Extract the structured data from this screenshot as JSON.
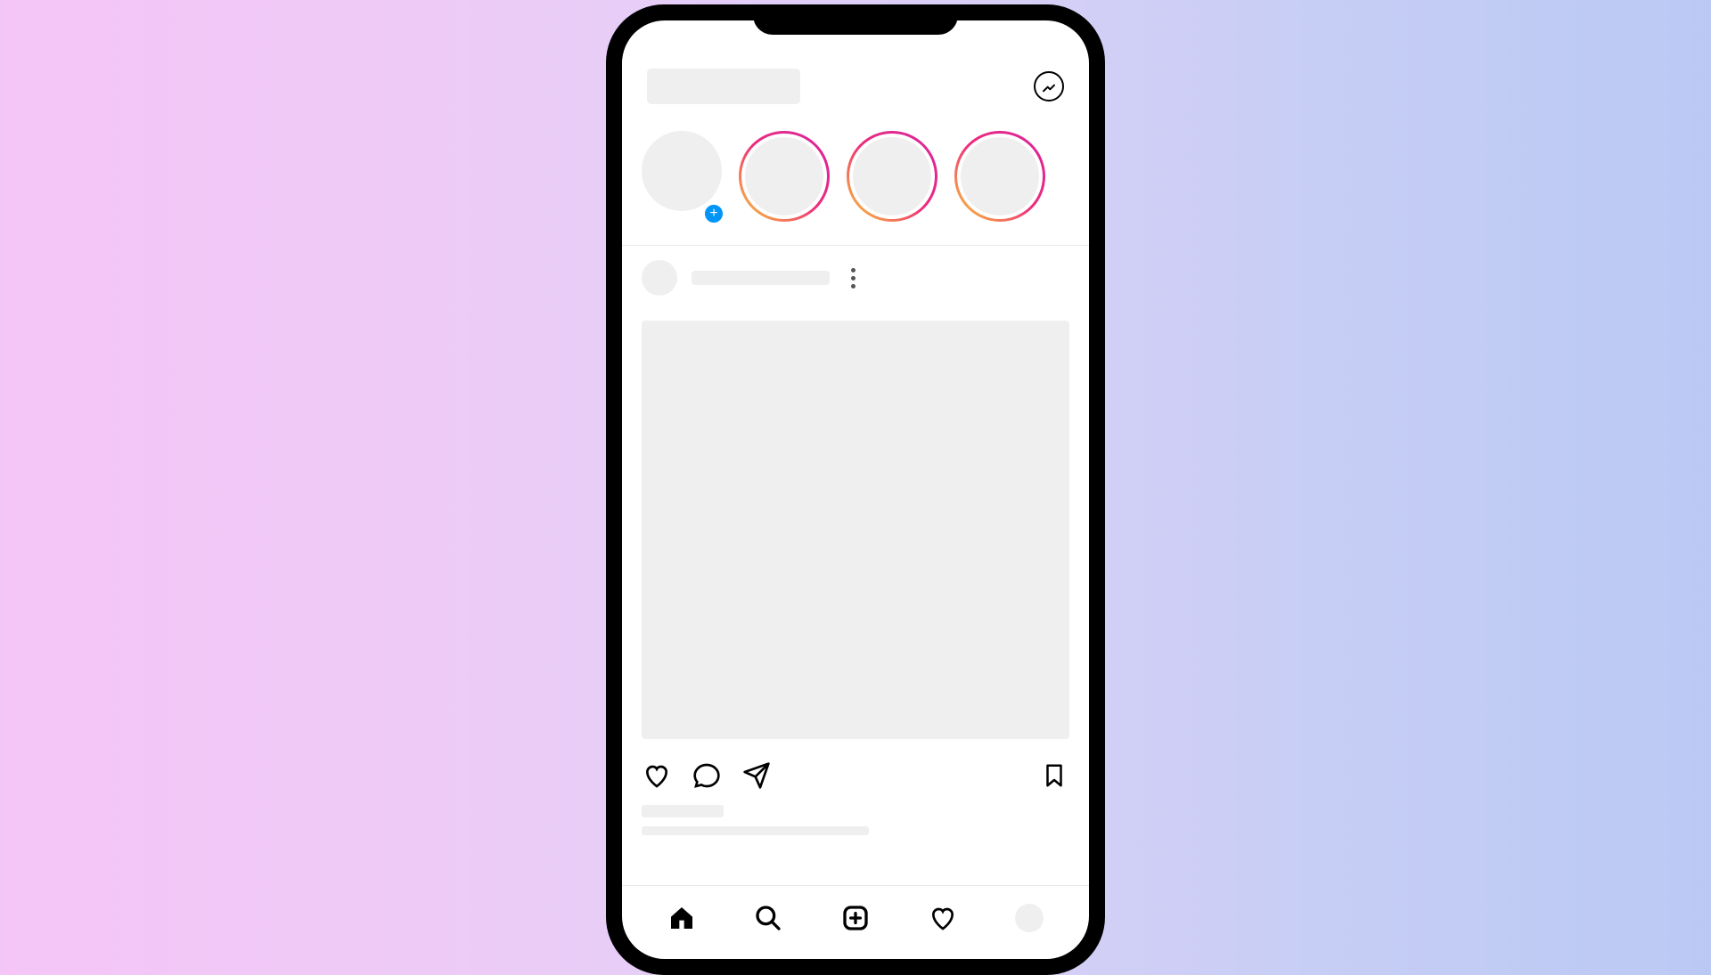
{
  "icons": {
    "messenger": "messenger-icon",
    "add": "plus-icon",
    "more": "more-icon",
    "like": "heart-icon",
    "comment": "comment-icon",
    "share": "send-icon",
    "bookmark": "bookmark-icon",
    "home": "home-icon",
    "search": "search-icon",
    "create": "create-icon",
    "activity": "heart-icon",
    "profile": "profile-icon"
  },
  "colors": {
    "background_gradient_start": "#f5c5f7",
    "background_gradient_end": "#bac9f4",
    "placeholder": "#efefef",
    "add_badge": "#0095f6",
    "story_ring_gradient": [
      "#f9ce34",
      "#ee2a7b",
      "#d6249f"
    ]
  },
  "stories": {
    "own": {
      "has_add": true
    },
    "items": [
      {
        "has_ring": true
      },
      {
        "has_ring": true
      },
      {
        "has_ring": true
      }
    ]
  },
  "post": {
    "username_placeholder": "",
    "image_placeholder": "",
    "likes_placeholder": "",
    "caption_placeholder": ""
  },
  "nav": {
    "active": "home"
  }
}
